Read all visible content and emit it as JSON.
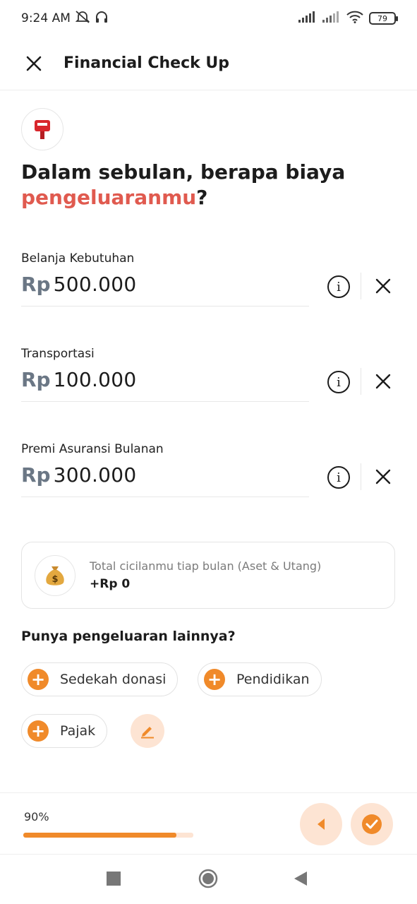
{
  "status_bar": {
    "time": "9:24 AM",
    "battery": "79"
  },
  "header": {
    "title": "Financial Check Up"
  },
  "question": {
    "part1": "Dalam sebulan, berapa biaya ",
    "highlight": "pengeluaranmu",
    "part2": "?"
  },
  "expenses": [
    {
      "label": "Belanja Kebutuhan",
      "currency": "Rp",
      "amount": "500.000"
    },
    {
      "label": "Transportasi",
      "currency": "Rp",
      "amount": "100.000"
    },
    {
      "label": "Premi Asuransi Bulanan",
      "currency": "Rp",
      "amount": "300.000"
    }
  ],
  "summary": {
    "label": "Total cicilanmu tiap bulan (Aset & Utang)",
    "value": "+Rp 0"
  },
  "other": {
    "title": "Punya pengeluaran lainnya?",
    "chips": [
      "Sedekah donasi",
      "Pendidikan",
      "Pajak"
    ]
  },
  "progress": {
    "label": "90%",
    "value": 0.9
  },
  "colors": {
    "accent": "#f08a2a",
    "accent_light": "#fde4d3",
    "highlight": "#e05a4f"
  },
  "icons": [
    "close-icon",
    "mailbox-icon",
    "info-icon",
    "remove-icon",
    "money-bag-icon",
    "plus-icon",
    "edit-icon",
    "back-icon",
    "check-icon"
  ]
}
